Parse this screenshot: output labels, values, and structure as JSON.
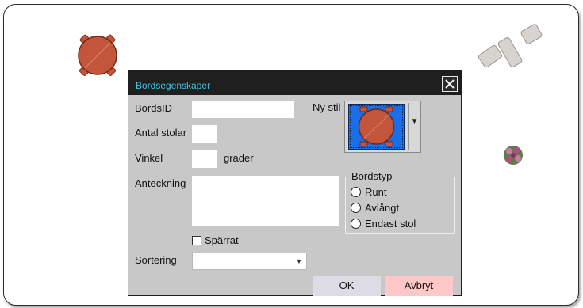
{
  "dialog": {
    "title": "Bordsegenskaper",
    "close_icon": "close-icon",
    "labels": {
      "table_id": "BordsID",
      "chairs": "Antal stolar",
      "angle": "Vinkel",
      "degrees": "grader",
      "note": "Anteckning",
      "new_style": "Ny stil",
      "locked": "Spärrat",
      "sorting": "Sortering"
    },
    "fields": {
      "table_id": "",
      "chairs": "",
      "angle": "",
      "note": "",
      "sorting": ""
    },
    "table_type": {
      "legend": "Bordstyp",
      "options": [
        "Runt",
        "Avlångt",
        "Endast stol"
      ]
    },
    "locked_checked": false,
    "buttons": {
      "ok": "OK",
      "cancel": "Avbryt"
    }
  },
  "colors": {
    "title_text": "#39c7e6",
    "titlebar": "#1f1f1f",
    "dialog_bg": "#c8c8c8",
    "style_preview_bg": "#1a6ee8",
    "table_top": "#c2553a",
    "ok_button": "#dcdce6",
    "cancel_button": "#ffc8c8"
  }
}
